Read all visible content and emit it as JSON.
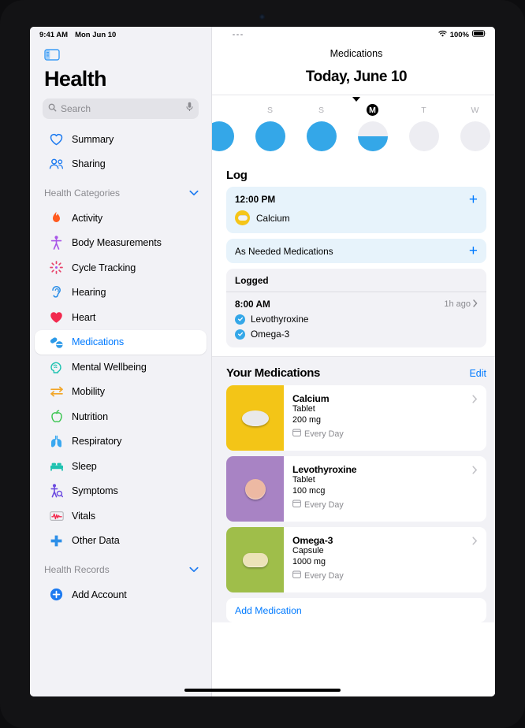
{
  "status_bar": {
    "time": "9:41 AM",
    "date": "Mon Jun 10",
    "battery": "100%"
  },
  "sidebar": {
    "toggle_icon": "sidebar-toggle-icon",
    "app_title": "Health",
    "search": {
      "placeholder": "Search",
      "icon": "search-icon",
      "mic_icon": "microphone-icon"
    },
    "top_items": [
      {
        "label": "Summary",
        "icon": "heart-outline-icon",
        "color": "#1e7bf0"
      },
      {
        "label": "Sharing",
        "icon": "two-people-icon",
        "color": "#1e7bf0"
      }
    ],
    "categories_header": {
      "label": "Health Categories",
      "chevron": "chevron-down-icon"
    },
    "categories": [
      {
        "label": "Activity",
        "icon": "flame-icon",
        "color": "#ff5a1f"
      },
      {
        "label": "Body Measurements",
        "icon": "body-icon",
        "color": "#a855e8"
      },
      {
        "label": "Cycle Tracking",
        "icon": "cycle-icon",
        "color": "#e8436a"
      },
      {
        "label": "Hearing",
        "icon": "ear-icon",
        "color": "#2d8fe8"
      },
      {
        "label": "Heart",
        "icon": "heart-filled-icon",
        "color": "#f2294e"
      },
      {
        "label": "Medications",
        "icon": "pills-icon",
        "color": "#2d9ae8",
        "selected": true
      },
      {
        "label": "Mental Wellbeing",
        "icon": "brain-head-icon",
        "color": "#1ec2b0"
      },
      {
        "label": "Mobility",
        "icon": "arrows-icon",
        "color": "#f2a526"
      },
      {
        "label": "Nutrition",
        "icon": "apple-icon",
        "color": "#38c44e"
      },
      {
        "label": "Respiratory",
        "icon": "lungs-icon",
        "color": "#3aa8f0"
      },
      {
        "label": "Sleep",
        "icon": "bed-icon",
        "color": "#1ec2b0"
      },
      {
        "label": "Symptoms",
        "icon": "person-search-icon",
        "color": "#6b4ae0"
      },
      {
        "label": "Vitals",
        "icon": "waveform-icon",
        "color": "#f2294e"
      },
      {
        "label": "Other Data",
        "icon": "plus-cross-icon",
        "color": "#2d8fe8"
      }
    ],
    "records_header": {
      "label": "Health Records",
      "chevron": "chevron-down-icon"
    },
    "add_account": {
      "label": "Add Account",
      "icon": "plus-circle-icon",
      "color": "#1e7bf0"
    }
  },
  "main": {
    "overflow_icon": "more-options-icon",
    "wifi_icon": "wifi-icon",
    "battery_icon": "battery-icon",
    "nav_title": "Medications",
    "big_date": "Today, June 10",
    "caret_icon": "caret-down-icon",
    "days": [
      {
        "label": "S",
        "fill": "full"
      },
      {
        "label": "S",
        "fill": "full"
      },
      {
        "label": "M",
        "fill": "half",
        "today": true
      },
      {
        "label": "T",
        "fill": "empty"
      },
      {
        "label": "W",
        "fill": "empty"
      }
    ],
    "log": {
      "heading": "Log",
      "scheduled": {
        "time": "12:00 PM",
        "add_icon": "plus-icon",
        "med_name": "Calcium",
        "med_color": "#f5c518"
      },
      "as_needed": {
        "label": "As Needed Medications",
        "add_icon": "plus-icon"
      },
      "logged": {
        "heading": "Logged",
        "time": "8:00 AM",
        "ago": "1h ago",
        "chevron": "chevron-right-icon",
        "items": [
          {
            "name": "Levothyroxine",
            "icon": "check-circle-icon"
          },
          {
            "name": "Omega-3",
            "icon": "check-circle-icon"
          }
        ]
      }
    },
    "your_medications": {
      "heading": "Your Medications",
      "edit_label": "Edit",
      "items": [
        {
          "name": "Calcium",
          "form": "Tablet",
          "dose": "200 mg",
          "frequency": "Every Day",
          "freq_icon": "calendar-icon",
          "chevron": "chevron-right-icon",
          "thumb_bg": "#f3c517",
          "pill_color": "#e9e9ea",
          "pill_shape": "oval"
        },
        {
          "name": "Levothyroxine",
          "form": "Tablet",
          "dose": "100 mcg",
          "frequency": "Every Day",
          "freq_icon": "calendar-icon",
          "chevron": "chevron-right-icon",
          "thumb_bg": "#a883c4",
          "pill_color": "#edb9a3",
          "pill_shape": "round"
        },
        {
          "name": "Omega-3",
          "form": "Capsule",
          "dose": "1000 mg",
          "frequency": "Every Day",
          "freq_icon": "calendar-icon",
          "chevron": "chevron-right-icon",
          "thumb_bg": "#9fbe4a",
          "pill_color": "#ece3b8",
          "pill_shape": "capsule"
        }
      ],
      "add_label": "Add Medication"
    }
  }
}
